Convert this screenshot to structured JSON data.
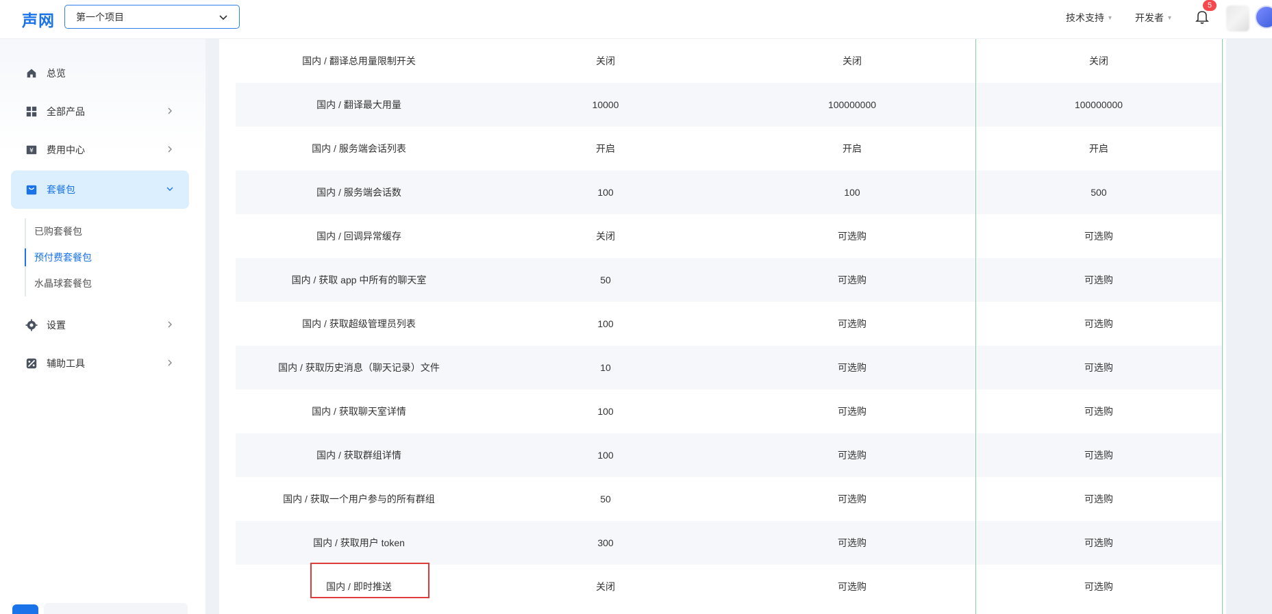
{
  "header": {
    "logo": "声网",
    "project": "第一个项目",
    "nav": [
      {
        "label": "技术支持"
      },
      {
        "label": "开发者"
      }
    ],
    "notifications_count": "5"
  },
  "sidebar": {
    "items": [
      {
        "label": "总览"
      },
      {
        "label": "全部产品"
      },
      {
        "label": "费用中心"
      },
      {
        "label": "套餐包"
      },
      {
        "label": "设置"
      },
      {
        "label": "辅助工具"
      }
    ],
    "sub_items": [
      {
        "label": "已购套餐包"
      },
      {
        "label": "预付费套餐包"
      },
      {
        "label": "水晶球套餐包"
      }
    ]
  },
  "table": {
    "rows": [
      {
        "name": "国内 / 翻译总用量限制开关",
        "v1": "关闭",
        "v2": "关闭",
        "v3": "关闭"
      },
      {
        "name": "国内 / 翻译最大用量",
        "v1": "10000",
        "v2": "100000000",
        "v3": "100000000"
      },
      {
        "name": "国内 / 服务端会话列表",
        "v1": "开启",
        "v2": "开启",
        "v3": "开启"
      },
      {
        "name": "国内 / 服务端会话数",
        "v1": "100",
        "v2": "100",
        "v3": "500"
      },
      {
        "name": "国内 / 回调异常缓存",
        "v1": "关闭",
        "v2": "可选购",
        "v3": "可选购"
      },
      {
        "name": "国内 / 获取 app 中所有的聊天室",
        "v1": "50",
        "v2": "可选购",
        "v3": "可选购"
      },
      {
        "name": "国内 / 获取超级管理员列表",
        "v1": "100",
        "v2": "可选购",
        "v3": "可选购"
      },
      {
        "name": "国内 / 获取历史消息（聊天记录）文件",
        "v1": "10",
        "v2": "可选购",
        "v3": "可选购"
      },
      {
        "name": "国内 / 获取聊天室详情",
        "v1": "100",
        "v2": "可选购",
        "v3": "可选购"
      },
      {
        "name": "国内 / 获取群组详情",
        "v1": "100",
        "v2": "可选购",
        "v3": "可选购"
      },
      {
        "name": "国内 / 获取一个用户参与的所有群组",
        "v1": "50",
        "v2": "可选购",
        "v3": "可选购"
      },
      {
        "name": "国内 / 获取用户 token",
        "v1": "300",
        "v2": "可选购",
        "v3": "可选购"
      },
      {
        "name": "国内 / 即时推送",
        "v1": "关闭",
        "v2": "可选购",
        "v3": "可选购"
      }
    ]
  }
}
